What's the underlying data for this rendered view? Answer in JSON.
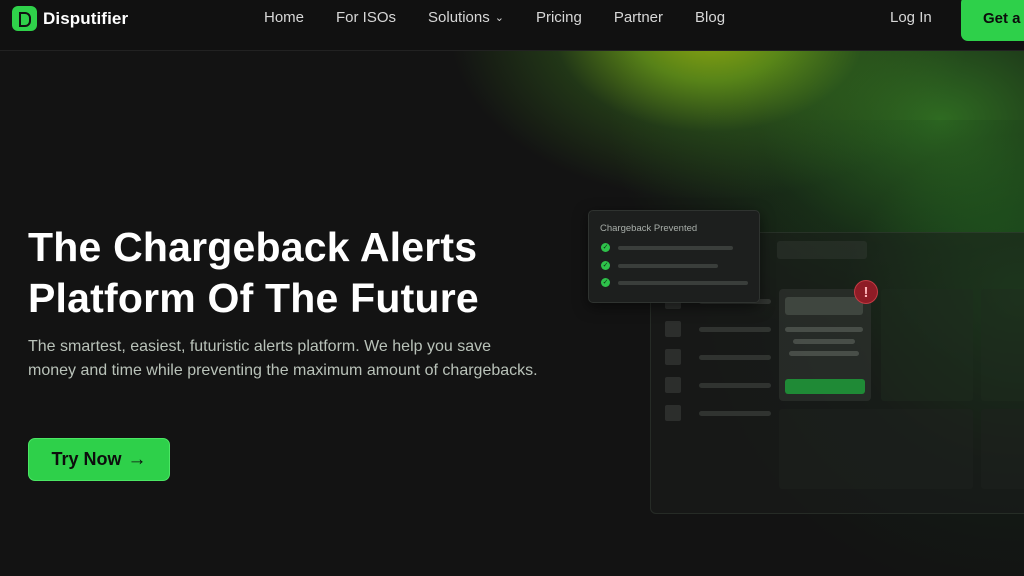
{
  "brand": {
    "name": "Disputifier",
    "accent": "#2ed04a",
    "background": "#131313"
  },
  "nav": {
    "items": [
      {
        "label": "Home"
      },
      {
        "label": "For ISOs"
      },
      {
        "label": "Solutions",
        "has_dropdown": true
      },
      {
        "label": "Pricing"
      },
      {
        "label": "Partner"
      },
      {
        "label": "Blog"
      }
    ],
    "login_label": "Log In",
    "cta_label": "Get a"
  },
  "hero": {
    "title_line1": "The Chargeback Alerts",
    "title_line2": "Platform Of The Future",
    "subtitle": "The smartest, easiest, futuristic alerts platform. We help you save money and time while preventing the maximum amount of chargebacks.",
    "button_label": "Try Now",
    "button_icon": "arrow-right-icon"
  },
  "illustration": {
    "card_title": "Chargeback Prevented",
    "check_icon": "check-circle-icon",
    "alert_icon": "exclamation-icon",
    "alert_symbol": "!",
    "alert_color": "#8e1c26"
  }
}
